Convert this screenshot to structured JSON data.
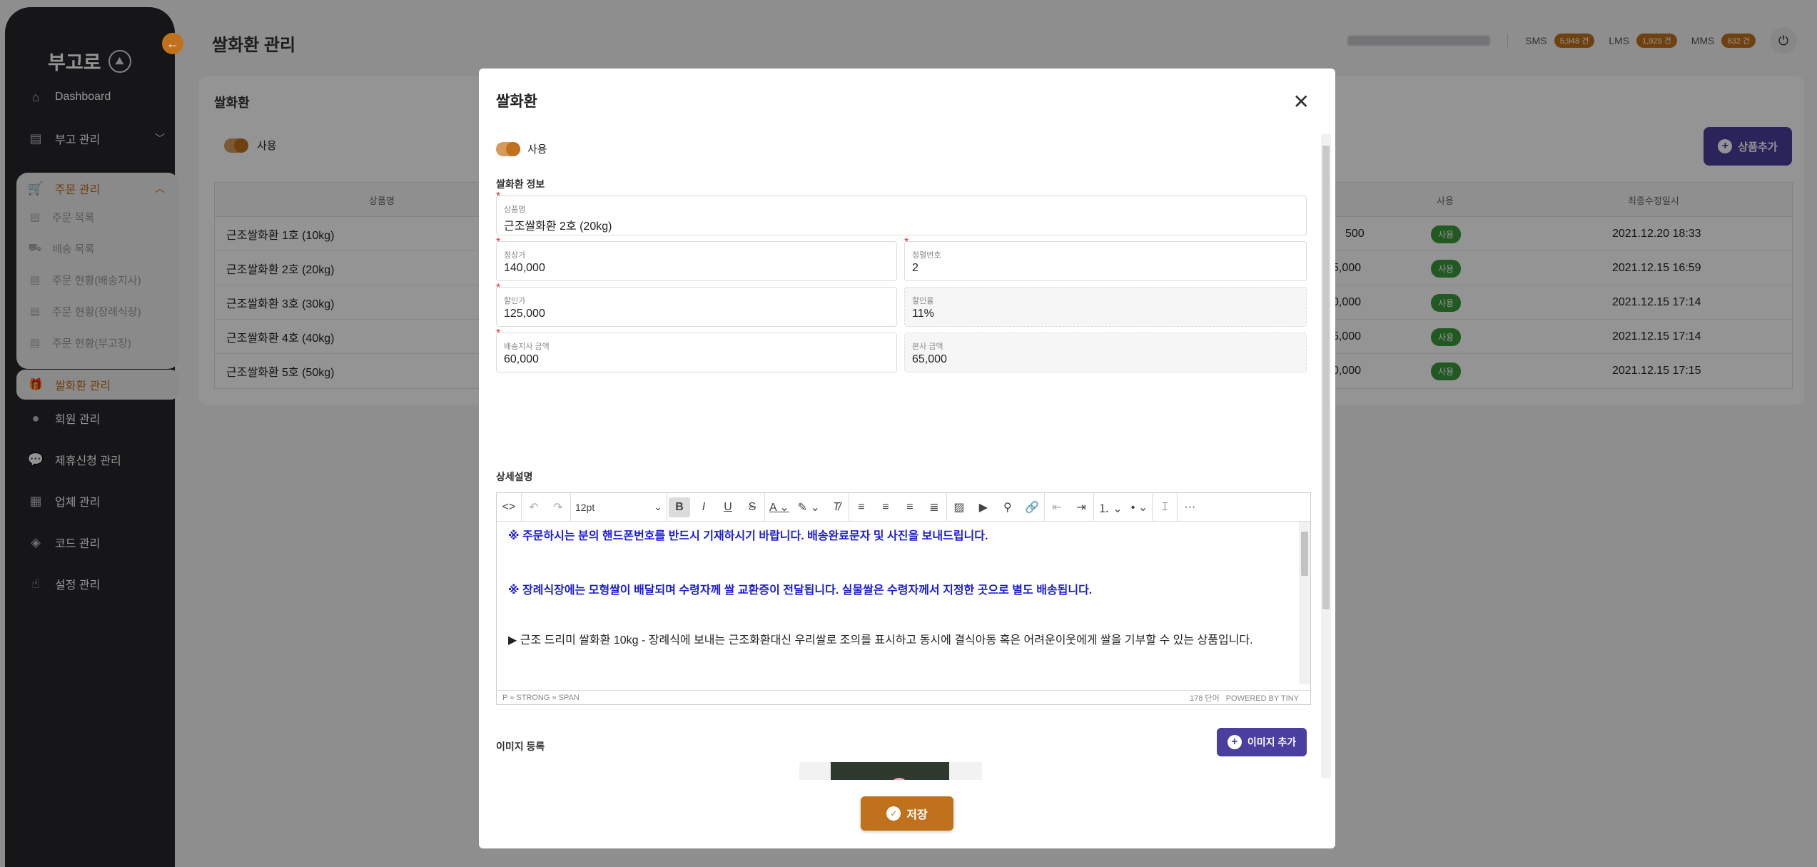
{
  "app": {
    "logo": "부고로",
    "page_title": "쌀화환 관리"
  },
  "topbar": {
    "sms_label": "SMS",
    "sms_count": "5,948 건",
    "lms_label": "LMS",
    "lms_count": "1,929 건",
    "mms_label": "MMS",
    "mms_count": "832 건"
  },
  "sidebar": {
    "dashboard": "Dashboard",
    "bugo": "부고 관리",
    "order": "주문 관리",
    "order_sub": [
      "주문 목록",
      "배송 목록",
      "주문 현황(배송지사)",
      "주문 현황(장례식장)",
      "주문 현황(부고장)"
    ],
    "rice": "쌀화환 관리",
    "member": "회원 관리",
    "partner": "제휴신청 관리",
    "company": "업체 관리",
    "code": "코드 관리",
    "settings": "설정 관리"
  },
  "bg_card": {
    "title": "쌀화환",
    "toggle_label": "사용",
    "add_button": "상품추가",
    "headers": {
      "name": "상품명",
      "use": "사용",
      "updated": "최종수정일시"
    },
    "rows": [
      {
        "name": "근조쌀화환 1호 (10kg)",
        "amount": "500",
        "use": "사용",
        "updated": "2021.12.20 18:33"
      },
      {
        "name": "근조쌀화환 2호 (20kg)",
        "amount": "5,000",
        "use": "사용",
        "updated": "2021.12.15 16:59"
      },
      {
        "name": "근조쌀화환 3호 (30kg)",
        "amount": "0,000",
        "use": "사용",
        "updated": "2021.12.15 17:14"
      },
      {
        "name": "근조쌀화환 4호 (40kg)",
        "amount": "5,000",
        "use": "사용",
        "updated": "2021.12.15 17:14"
      },
      {
        "name": "근조쌀화환 5호 (50kg)",
        "amount": "0,000",
        "use": "사용",
        "updated": "2021.12.15 17:15"
      }
    ]
  },
  "modal": {
    "title": "쌀화환",
    "toggle_label": "사용",
    "info_section": "쌀화환 정보",
    "fields": {
      "product_name": {
        "label": "상품명",
        "value": "근조쌀화환 2호 (20kg)"
      },
      "list_price": {
        "label": "정상가",
        "value": "140,000"
      },
      "sort_order": {
        "label": "정렬번호",
        "value": "2"
      },
      "sale_price": {
        "label": "할인가",
        "value": "125,000"
      },
      "discount_rate": {
        "label": "할인율",
        "value": "11%"
      },
      "branch_amount": {
        "label": "배송지사 금액",
        "value": "60,000"
      },
      "hq_amount": {
        "label": "본사 금액",
        "value": "65,000"
      }
    },
    "detail_section": "상세설명",
    "editor": {
      "font_size": "12pt",
      "line1": "※ 주문하시는 분의 핸드폰번호를 반드시 기재하시기 바랍니다. 배송완료문자 및 사진을 보내드립니다.",
      "line2": "※ 장례식장에는 모형쌀이 배달되며 수령자께 쌀 교환증이 전달됩니다. 실물쌀은 수령자께서 지정한 곳으로 별도 배송됩니다.",
      "line3": "▶ 근조 드리미 쌀화환 10kg - 장례식에 보내는 근조화환대신 우리쌀로 조의를 표시하고 동시에 결식아동 혹은 어려운이웃에게 쌀을 기부할 수 있는 상품입니다.",
      "path": "P » STRONG » SPAN",
      "word_count": "178 단어",
      "powered": "POWERED BY TINY"
    },
    "image_section": "이미지 등록",
    "image_add_button": "이미지 추가",
    "save_button": "저장"
  },
  "colors": {
    "accent": "#c0711c",
    "primary": "#4a3e9e",
    "sidebar": "#26272c",
    "use_badge": "#3c9a3c",
    "editor_blue": "#1a1adc"
  }
}
